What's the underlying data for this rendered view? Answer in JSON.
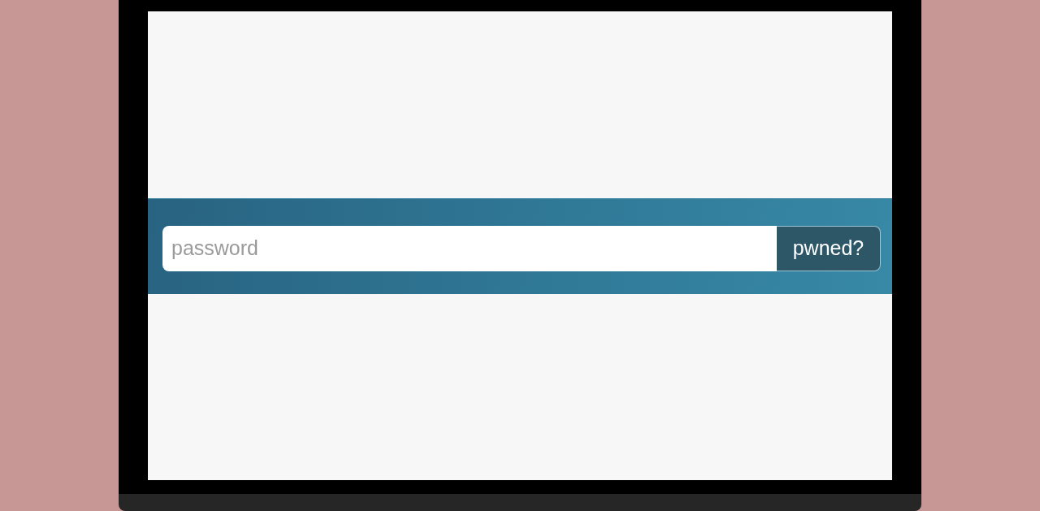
{
  "search": {
    "placeholder": "password",
    "button": "pwned?"
  }
}
